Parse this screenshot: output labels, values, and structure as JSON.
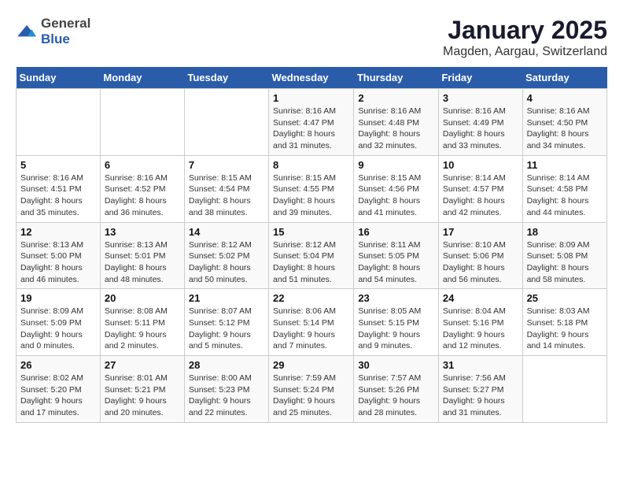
{
  "logo": {
    "text_general": "General",
    "text_blue": "Blue"
  },
  "title": "January 2025",
  "subtitle": "Magden, Aargau, Switzerland",
  "weekdays": [
    "Sunday",
    "Monday",
    "Tuesday",
    "Wednesday",
    "Thursday",
    "Friday",
    "Saturday"
  ],
  "weeks": [
    [
      {
        "day": "",
        "sunrise": "",
        "sunset": "",
        "daylight": ""
      },
      {
        "day": "",
        "sunrise": "",
        "sunset": "",
        "daylight": ""
      },
      {
        "day": "",
        "sunrise": "",
        "sunset": "",
        "daylight": ""
      },
      {
        "day": "1",
        "sunrise": "Sunrise: 8:16 AM",
        "sunset": "Sunset: 4:47 PM",
        "daylight": "Daylight: 8 hours and 31 minutes."
      },
      {
        "day": "2",
        "sunrise": "Sunrise: 8:16 AM",
        "sunset": "Sunset: 4:48 PM",
        "daylight": "Daylight: 8 hours and 32 minutes."
      },
      {
        "day": "3",
        "sunrise": "Sunrise: 8:16 AM",
        "sunset": "Sunset: 4:49 PM",
        "daylight": "Daylight: 8 hours and 33 minutes."
      },
      {
        "day": "4",
        "sunrise": "Sunrise: 8:16 AM",
        "sunset": "Sunset: 4:50 PM",
        "daylight": "Daylight: 8 hours and 34 minutes."
      }
    ],
    [
      {
        "day": "5",
        "sunrise": "Sunrise: 8:16 AM",
        "sunset": "Sunset: 4:51 PM",
        "daylight": "Daylight: 8 hours and 35 minutes."
      },
      {
        "day": "6",
        "sunrise": "Sunrise: 8:16 AM",
        "sunset": "Sunset: 4:52 PM",
        "daylight": "Daylight: 8 hours and 36 minutes."
      },
      {
        "day": "7",
        "sunrise": "Sunrise: 8:15 AM",
        "sunset": "Sunset: 4:54 PM",
        "daylight": "Daylight: 8 hours and 38 minutes."
      },
      {
        "day": "8",
        "sunrise": "Sunrise: 8:15 AM",
        "sunset": "Sunset: 4:55 PM",
        "daylight": "Daylight: 8 hours and 39 minutes."
      },
      {
        "day": "9",
        "sunrise": "Sunrise: 8:15 AM",
        "sunset": "Sunset: 4:56 PM",
        "daylight": "Daylight: 8 hours and 41 minutes."
      },
      {
        "day": "10",
        "sunrise": "Sunrise: 8:14 AM",
        "sunset": "Sunset: 4:57 PM",
        "daylight": "Daylight: 8 hours and 42 minutes."
      },
      {
        "day": "11",
        "sunrise": "Sunrise: 8:14 AM",
        "sunset": "Sunset: 4:58 PM",
        "daylight": "Daylight: 8 hours and 44 minutes."
      }
    ],
    [
      {
        "day": "12",
        "sunrise": "Sunrise: 8:13 AM",
        "sunset": "Sunset: 5:00 PM",
        "daylight": "Daylight: 8 hours and 46 minutes."
      },
      {
        "day": "13",
        "sunrise": "Sunrise: 8:13 AM",
        "sunset": "Sunset: 5:01 PM",
        "daylight": "Daylight: 8 hours and 48 minutes."
      },
      {
        "day": "14",
        "sunrise": "Sunrise: 8:12 AM",
        "sunset": "Sunset: 5:02 PM",
        "daylight": "Daylight: 8 hours and 50 minutes."
      },
      {
        "day": "15",
        "sunrise": "Sunrise: 8:12 AM",
        "sunset": "Sunset: 5:04 PM",
        "daylight": "Daylight: 8 hours and 51 minutes."
      },
      {
        "day": "16",
        "sunrise": "Sunrise: 8:11 AM",
        "sunset": "Sunset: 5:05 PM",
        "daylight": "Daylight: 8 hours and 54 minutes."
      },
      {
        "day": "17",
        "sunrise": "Sunrise: 8:10 AM",
        "sunset": "Sunset: 5:06 PM",
        "daylight": "Daylight: 8 hours and 56 minutes."
      },
      {
        "day": "18",
        "sunrise": "Sunrise: 8:09 AM",
        "sunset": "Sunset: 5:08 PM",
        "daylight": "Daylight: 8 hours and 58 minutes."
      }
    ],
    [
      {
        "day": "19",
        "sunrise": "Sunrise: 8:09 AM",
        "sunset": "Sunset: 5:09 PM",
        "daylight": "Daylight: 9 hours and 0 minutes."
      },
      {
        "day": "20",
        "sunrise": "Sunrise: 8:08 AM",
        "sunset": "Sunset: 5:11 PM",
        "daylight": "Daylight: 9 hours and 2 minutes."
      },
      {
        "day": "21",
        "sunrise": "Sunrise: 8:07 AM",
        "sunset": "Sunset: 5:12 PM",
        "daylight": "Daylight: 9 hours and 5 minutes."
      },
      {
        "day": "22",
        "sunrise": "Sunrise: 8:06 AM",
        "sunset": "Sunset: 5:14 PM",
        "daylight": "Daylight: 9 hours and 7 minutes."
      },
      {
        "day": "23",
        "sunrise": "Sunrise: 8:05 AM",
        "sunset": "Sunset: 5:15 PM",
        "daylight": "Daylight: 9 hours and 9 minutes."
      },
      {
        "day": "24",
        "sunrise": "Sunrise: 8:04 AM",
        "sunset": "Sunset: 5:16 PM",
        "daylight": "Daylight: 9 hours and 12 minutes."
      },
      {
        "day": "25",
        "sunrise": "Sunrise: 8:03 AM",
        "sunset": "Sunset: 5:18 PM",
        "daylight": "Daylight: 9 hours and 14 minutes."
      }
    ],
    [
      {
        "day": "26",
        "sunrise": "Sunrise: 8:02 AM",
        "sunset": "Sunset: 5:20 PM",
        "daylight": "Daylight: 9 hours and 17 minutes."
      },
      {
        "day": "27",
        "sunrise": "Sunrise: 8:01 AM",
        "sunset": "Sunset: 5:21 PM",
        "daylight": "Daylight: 9 hours and 20 minutes."
      },
      {
        "day": "28",
        "sunrise": "Sunrise: 8:00 AM",
        "sunset": "Sunset: 5:23 PM",
        "daylight": "Daylight: 9 hours and 22 minutes."
      },
      {
        "day": "29",
        "sunrise": "Sunrise: 7:59 AM",
        "sunset": "Sunset: 5:24 PM",
        "daylight": "Daylight: 9 hours and 25 minutes."
      },
      {
        "day": "30",
        "sunrise": "Sunrise: 7:57 AM",
        "sunset": "Sunset: 5:26 PM",
        "daylight": "Daylight: 9 hours and 28 minutes."
      },
      {
        "day": "31",
        "sunrise": "Sunrise: 7:56 AM",
        "sunset": "Sunset: 5:27 PM",
        "daylight": "Daylight: 9 hours and 31 minutes."
      },
      {
        "day": "",
        "sunrise": "",
        "sunset": "",
        "daylight": ""
      }
    ]
  ]
}
